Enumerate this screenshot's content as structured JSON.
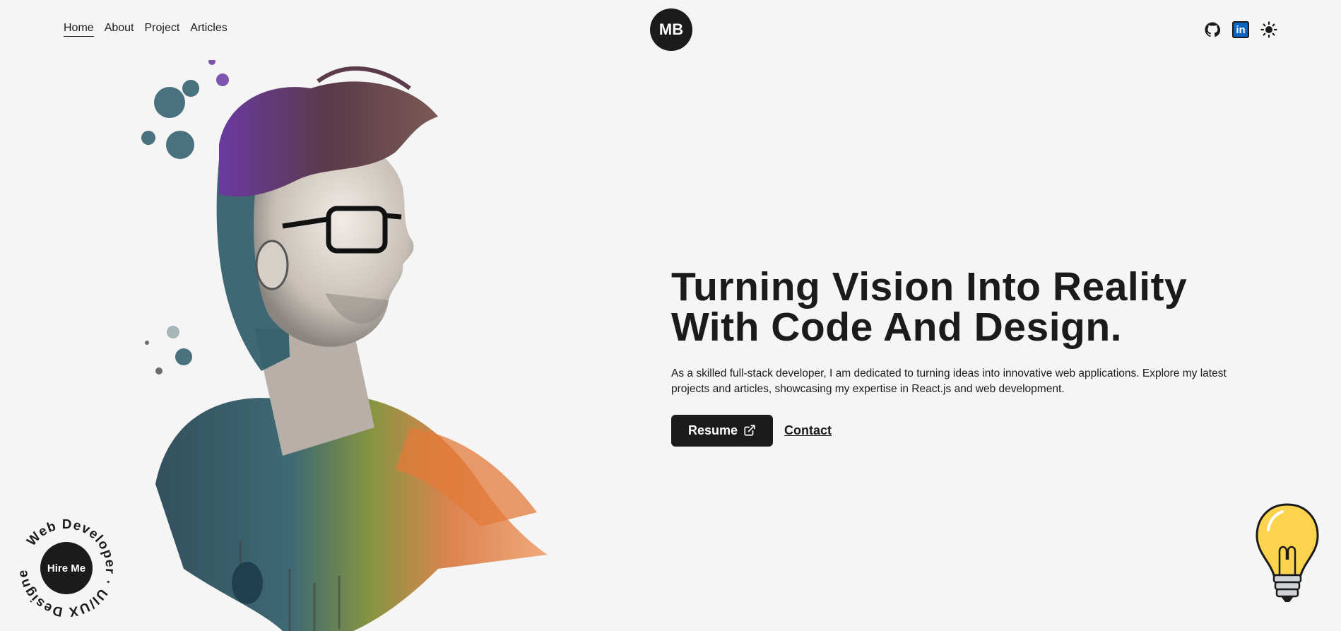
{
  "nav": {
    "links": [
      {
        "label": "Home"
      },
      {
        "label": "About"
      },
      {
        "label": "Project"
      },
      {
        "label": "Articles"
      }
    ],
    "logo": "MB"
  },
  "socials": {
    "icons": [
      "github-icon",
      "linkedin-icon",
      "sun-icon"
    ],
    "linkedin_text": "in"
  },
  "hero": {
    "title_line1": "Turning Vision Into Reality",
    "title_line2": "With Code And Design.",
    "description": "As a skilled full-stack developer, I am dedicated to turning ideas into innovative web applications. Explore my latest projects and articles, showcasing my expertise in React.js and web development.",
    "resume_label": "Resume",
    "contact_label": "Contact"
  },
  "badge": {
    "hire_label": "Hire Me",
    "ring_text": "Web Developer · UI/UX Designer · "
  },
  "colors": {
    "background": "#f5f5f5",
    "dark": "#1b1b1b",
    "linkedin": "#0a66c2"
  }
}
